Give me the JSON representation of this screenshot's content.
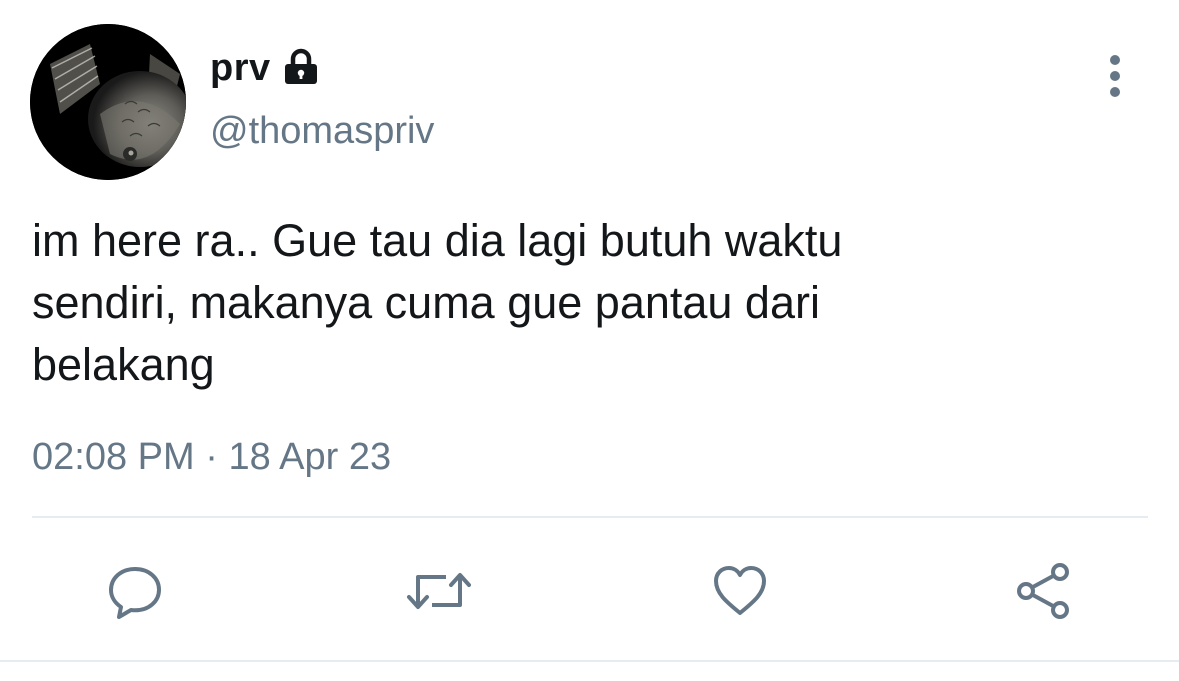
{
  "tweet": {
    "display_name": "prv",
    "handle": "@thomaspriv",
    "text_lines": [
      "im here ra.. Gue tau dia lagi butuh waktu",
      "sendiri, makanya cuma gue pantau dari",
      "belakang"
    ],
    "time": "02:08 PM",
    "separator": "·",
    "date": "18 Apr 23"
  },
  "icons": {
    "lock": "lock-icon",
    "more": "more-vertical-icon",
    "reply": "reply-icon",
    "retweet": "retweet-icon",
    "like": "like-icon",
    "share": "share-icon"
  },
  "colors": {
    "text": "#14171a",
    "secondary": "#657786",
    "divider": "#e6ecf0"
  }
}
